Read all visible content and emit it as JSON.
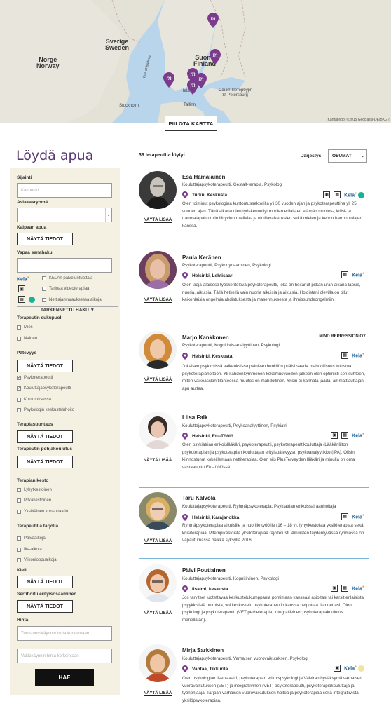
{
  "map": {
    "labels": {
      "norway": "Norge\nNorway",
      "sweden": "Sverige\nSweden",
      "finland": "Suomi\nFinland",
      "stockholm": "Stockholm",
      "helsinki": "Helsinki",
      "tallinn": "Tallinn",
      "st_petersburg": "Санкт-Петербург\nSt Petersburg",
      "gulf": "Gulf of Bothnia"
    },
    "attribution": "Karttatiedot ©2015 GeoBasis-DE/BKG (",
    "hide_button": "PIILOTA KARTTA",
    "colors": {
      "water": "#b9d5ec",
      "land": "#e8e6dc",
      "marker": "#7a3b8c"
    }
  },
  "page_title": "Löydä apua",
  "sidebar": {
    "location_label": "Sijainti",
    "location_placeholder": "Kaupunki...",
    "client_group_label": "Asiakasryhmä",
    "client_group_value": "---------",
    "need_help_label": "Kaipaan apua",
    "show_info_1": "NÄYTÄ TIEDOT",
    "free_search_label": "Vapaa sanahaku",
    "kela_label": "Kela",
    "kela_option": "KELAn palveluntuottaja",
    "video_option": "Tarjoaa videoterapiaa",
    "online_option": "Nettiajanvarauksessa aikoja",
    "advanced_search": "TARKENNETTU HAKU ▼",
    "gender_label": "Terapeutin sukupuoli",
    "gender_male": "Mies",
    "gender_female": "Nainen",
    "role_label": "Pätevyys",
    "show_info_2": "NÄYTÄ TIEDOT",
    "role_options": [
      "Psykoterapeutti",
      "Kouluttajapsykoterapeutti",
      "Koulutuksessa",
      "Psykologin keskusteluhoito"
    ],
    "role_checked": [
      "✓",
      "✓",
      "",
      ""
    ],
    "orientation_label": "Terapiasuuntaus",
    "show_info_3": "NÄYTÄ TIEDOT",
    "education_label": "Terapeutin pohjakoulutus",
    "show_info_4": "NÄYTÄ TIEDOT",
    "duration_label": "Terapian kesto",
    "duration_options": [
      "Lyhytkestoinen",
      "Pitkäkestoinen",
      "Yksittäinen konsultaatio"
    ],
    "offers_label": "Terapeutilla tarjolla",
    "offers_options": [
      "Päiväaikoja",
      "Ilta-aikoja",
      "Viikonloppuaikoja"
    ],
    "language_label": "Kieli",
    "show_info_5": "NÄYTÄ TIEDOT",
    "special_label": "Sertifioitu erityisosaaminen",
    "show_info_6": "NÄYTÄ TIEDOT",
    "price_label": "Hinta",
    "price_first_placeholder": "Tutustumiskäynnin hinta korkeintaan",
    "price_regular_placeholder": "Vakiokäynnin hinta korkeintaan",
    "search_button": "HAE"
  },
  "results": {
    "count_text": "39 terapeuttia löytyi",
    "sort_label": "Järjestys",
    "sort_value": "OSUMAT",
    "more_label": "NÄYTÄ LISÄÄ",
    "kela_text": "Kela",
    "therapists": [
      {
        "name": "Esa Hämäläinen",
        "org": "",
        "titles": "Kouluttajapsykoterapeutti, Gestalt-terapia, Psykologi",
        "location": "Turku, Keskusta",
        "description": "Olen toiminut psykologina kuntoutussektorilla yli 30 vuoden ajan ja psykoterapeuttina yli 25 vuoden ajan. Tänä aikana olen työskennellyt monien erilaisten elämän muutos-, kriisi- ja traumatapahtumiin liittyvien mielialа- ja olotilavaikeuksien sekä mielen ja kehon harmoniolajen kanssa."
      },
      {
        "name": "Paula Keränen",
        "org": "",
        "titles": "Psykoterapeutti, Psykodynaaminen, Psykologi",
        "location": "Helsinki, Lehtisaari",
        "description": "Olen laaja-alaisesti työskentelevä psykoterapeutti, joka on hoitanut pitkan uran aikana lapsia, nuoria, aikuisia. Tällä hetkellä vain nuoria aikuisia ja aikuisia. Holdistani olevilla on ollut kaikenlaisia ongelmia ahdistuksesta ja masennuksesta ja ihmissuhdeongelmiin."
      },
      {
        "name": "Marjo Kankkonen",
        "org": "MIND REPRESSION OY",
        "titles": "Psykoterapeutti, Kognitiivis-analyyttinen, Psykologi",
        "location": "Helsinki, Keskusta",
        "description": "Jokaisen psykkisissä vaikeuksissa painivan henkilön pitäisi saada mahdollisuus tutustua psykoterapiahoitoon. Yli kahdenkymmenen kokemusvuoden jälkeen olen optimisti sen suhteen, miten vaikeasskin tilanteessa muutos on mahdollinen. Yksin ei kannata jäädä, ammattiauttajan apu auttaa."
      },
      {
        "name": "Liisa Falk",
        "org": "",
        "titles": "Kouluttajapsykoterapeutti, Psykoanalyyttinen, Psykiatri",
        "location": "Helsinki, Etu-Töölö",
        "description": "Olen psykiatrian erikoislääkäri, psykoterapeutti, psykoterapeuttikouluttaja (Lääkäriliiton psykoterapian ja psykoterapian kouluttajan erityispätevyys), psykoanalyytikko (IPA). Olisin kiinnostunut kokeillemaan nettiterapiaa. Olen siis PlusTerveyden lääkäri ja minulla on oma vastaanotto Etu-töölössä."
      },
      {
        "name": "Taru Kalvola",
        "org": "",
        "titles": "Kouluttajapsykoterapeutti, Ryhmäpsykoterapia, Psykiatrian erikoissairaanhoitaja",
        "location": "Helsinki, Karajanokka",
        "description": "Ryhmäpsykoterapiaa aikuisille ja nuorille työöille (16 – 18 v), lyhytkestoista yksilöterapiaa sekä kriisiterapiaa. Pitempikestoista yksilöterapiaa rajoitetusti. Aikuisten täydentyvässä ryhmässä on vapautumassa paikka syksyllä 2016."
      },
      {
        "name": "Päivi Poutiainen",
        "org": "",
        "titles": "Kouluttajapsykoterapeutti, Kognitiivinen, Psykologi",
        "location": "Iisalmi, keskusta",
        "description": "Jos tarvitset luotettavaa keskustelukumppania pohtimaan kanssasi asioitasi tai karsit erilaisista psyykkisistä pulmista, voi keskustelu psykoterapeutin kanssa helpottaa tilannettasi. Olen psykologi ja psykoterapeutti (VET perheterapia, integratiivinen psykoterapiakoulutus menellätän)."
      },
      {
        "name": "Mirja Sarkkinen",
        "org": "",
        "titles": "Kouluttajapsykoterapeutti, Varhaisen vuorovaikutuksen, Psykologi",
        "location": "Vantaa, Tikkurila",
        "description": "Olen psykologian lisensiaatti, psykoterapian erikoispsykologi ja Valviran hyväksymä varhaisen vuorovaikutuksen (VET) ja integratiivinen (VET) psykoterapeutti, psykoterapiakouluttaja ja työnohjaaja. Tarjoan varhaisen vuorovaikutuksen hoitoa ja psykoterapiaa sekä integratiivistä yksilöpsykoterapiaa."
      }
    ]
  }
}
